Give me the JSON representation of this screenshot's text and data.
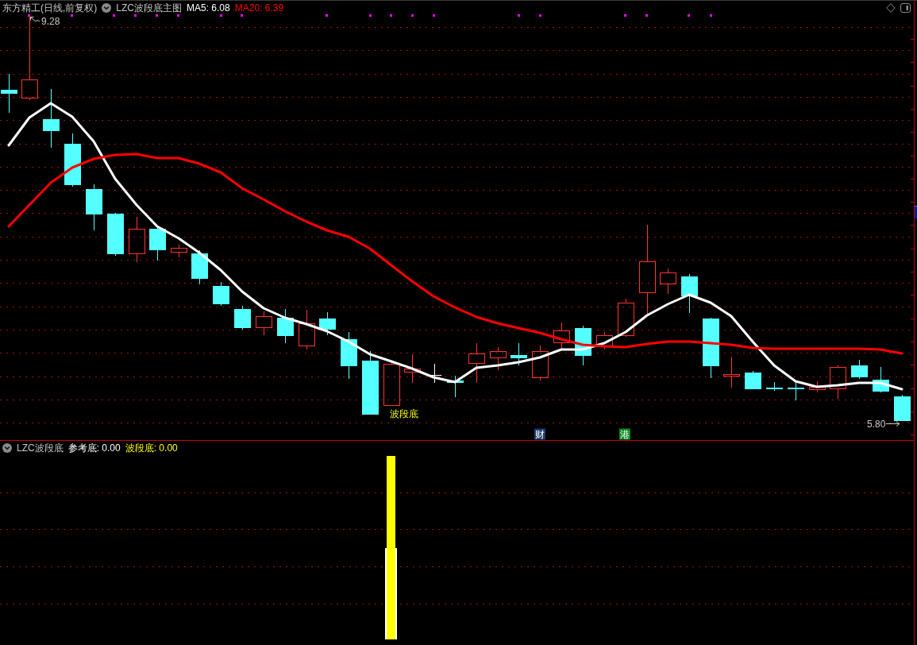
{
  "main_chart": {
    "title": "东方精工(日线,前复权)",
    "indicator": "LZC波段底主图",
    "legend": [
      {
        "label": "MA5: 6.08",
        "color": "#ffffff"
      },
      {
        "label": "MA20: 6.39",
        "color": "#ff0000"
      }
    ],
    "high_label": "9.28",
    "low_label": "5.80",
    "signal_label": "波段底",
    "event_tags": [
      {
        "text": "财",
        "color": "#1b3d6d"
      },
      {
        "text": "港",
        "color": "#0b8a1f"
      }
    ]
  },
  "sub_chart": {
    "indicator": "LZC波段底",
    "legend": [
      {
        "label": "参考底: 0.00",
        "color": "#ffffff"
      },
      {
        "label": "波段底: 0.00",
        "color": "#ffff00"
      }
    ]
  }
}
